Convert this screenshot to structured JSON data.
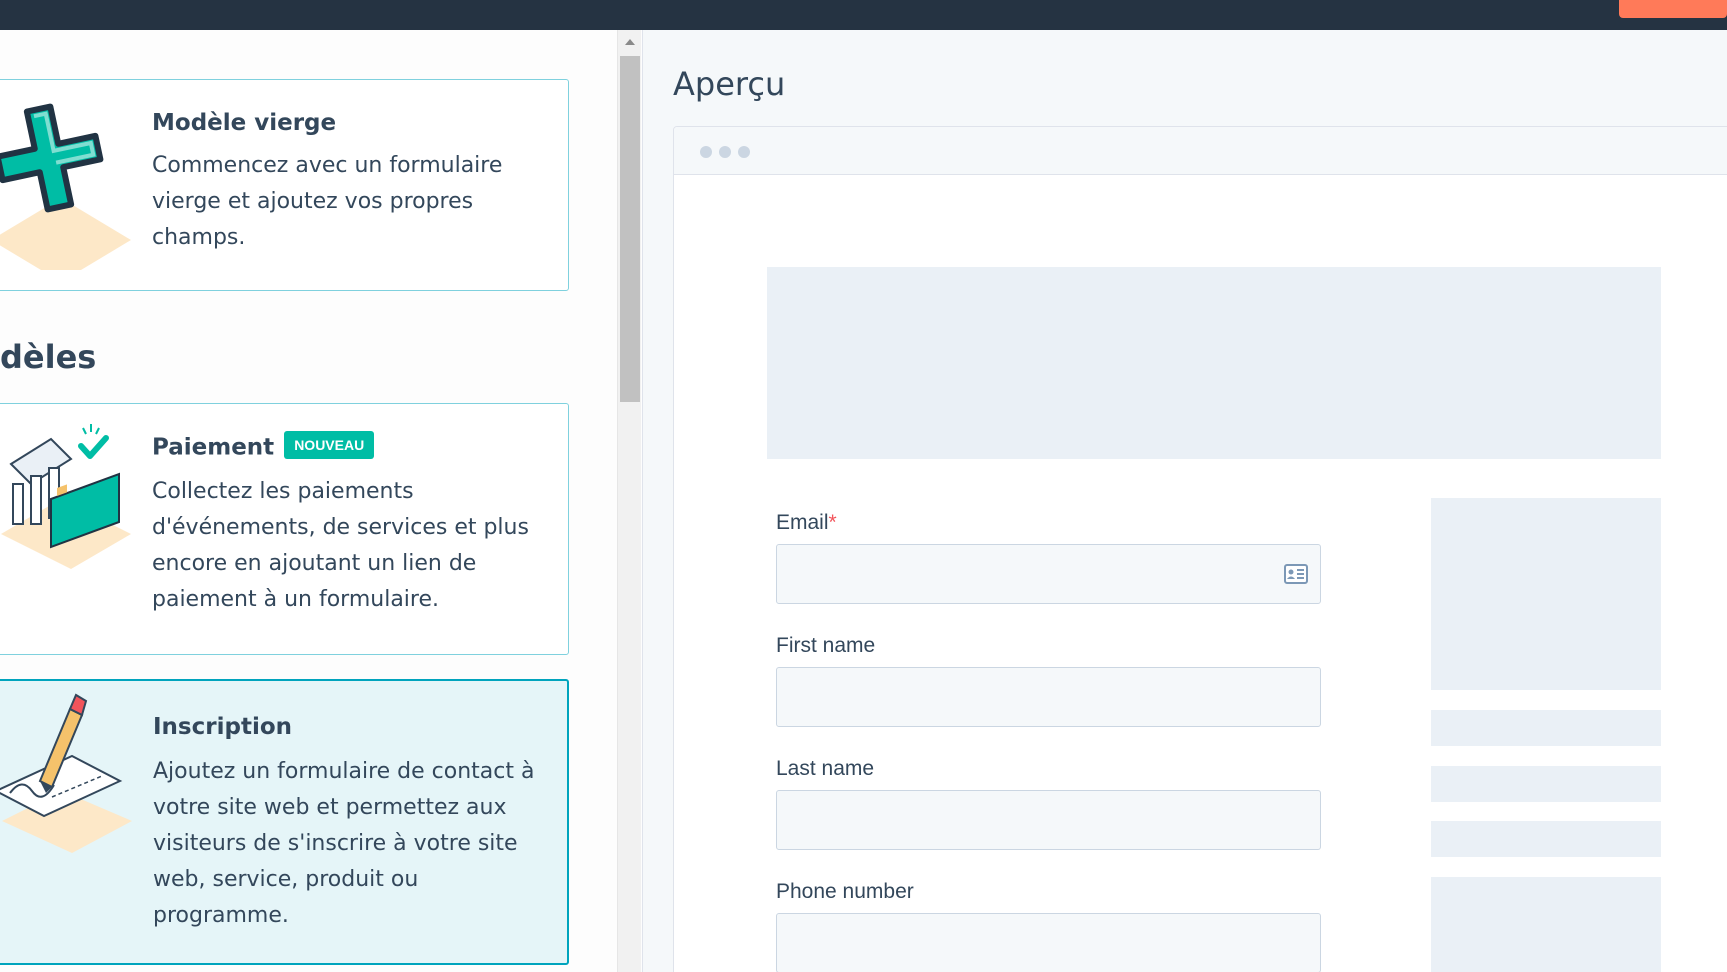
{
  "left_panel": {
    "cards": [
      {
        "title": "Modèle vierge",
        "description": "Commencez avec un formulaire vierge et ajoutez vos propres champs."
      },
      {
        "title": "Paiement",
        "badge": "NOUVEAU",
        "description": "Collectez les paiements d'événements, de services et plus encore en ajoutant un lien de paiement à un formulaire."
      },
      {
        "title": "Inscription",
        "description": "Ajoutez un formulaire de contact à votre site web et permettez aux visiteurs de s'inscrire à votre site web, service, produit ou programme.",
        "selected": true
      }
    ],
    "section_heading": "dèles"
  },
  "preview": {
    "title": "Aperçu",
    "form": {
      "fields": [
        {
          "label": "Email",
          "required_marker": "*",
          "value": ""
        },
        {
          "label": "First name",
          "value": ""
        },
        {
          "label": "Last name",
          "value": ""
        },
        {
          "label": "Phone number",
          "value": ""
        }
      ]
    }
  },
  "colors": {
    "topbar": "#253342",
    "accent": "#ff7a59",
    "selected_border": "#00a4bd",
    "badge": "#00bda5"
  }
}
